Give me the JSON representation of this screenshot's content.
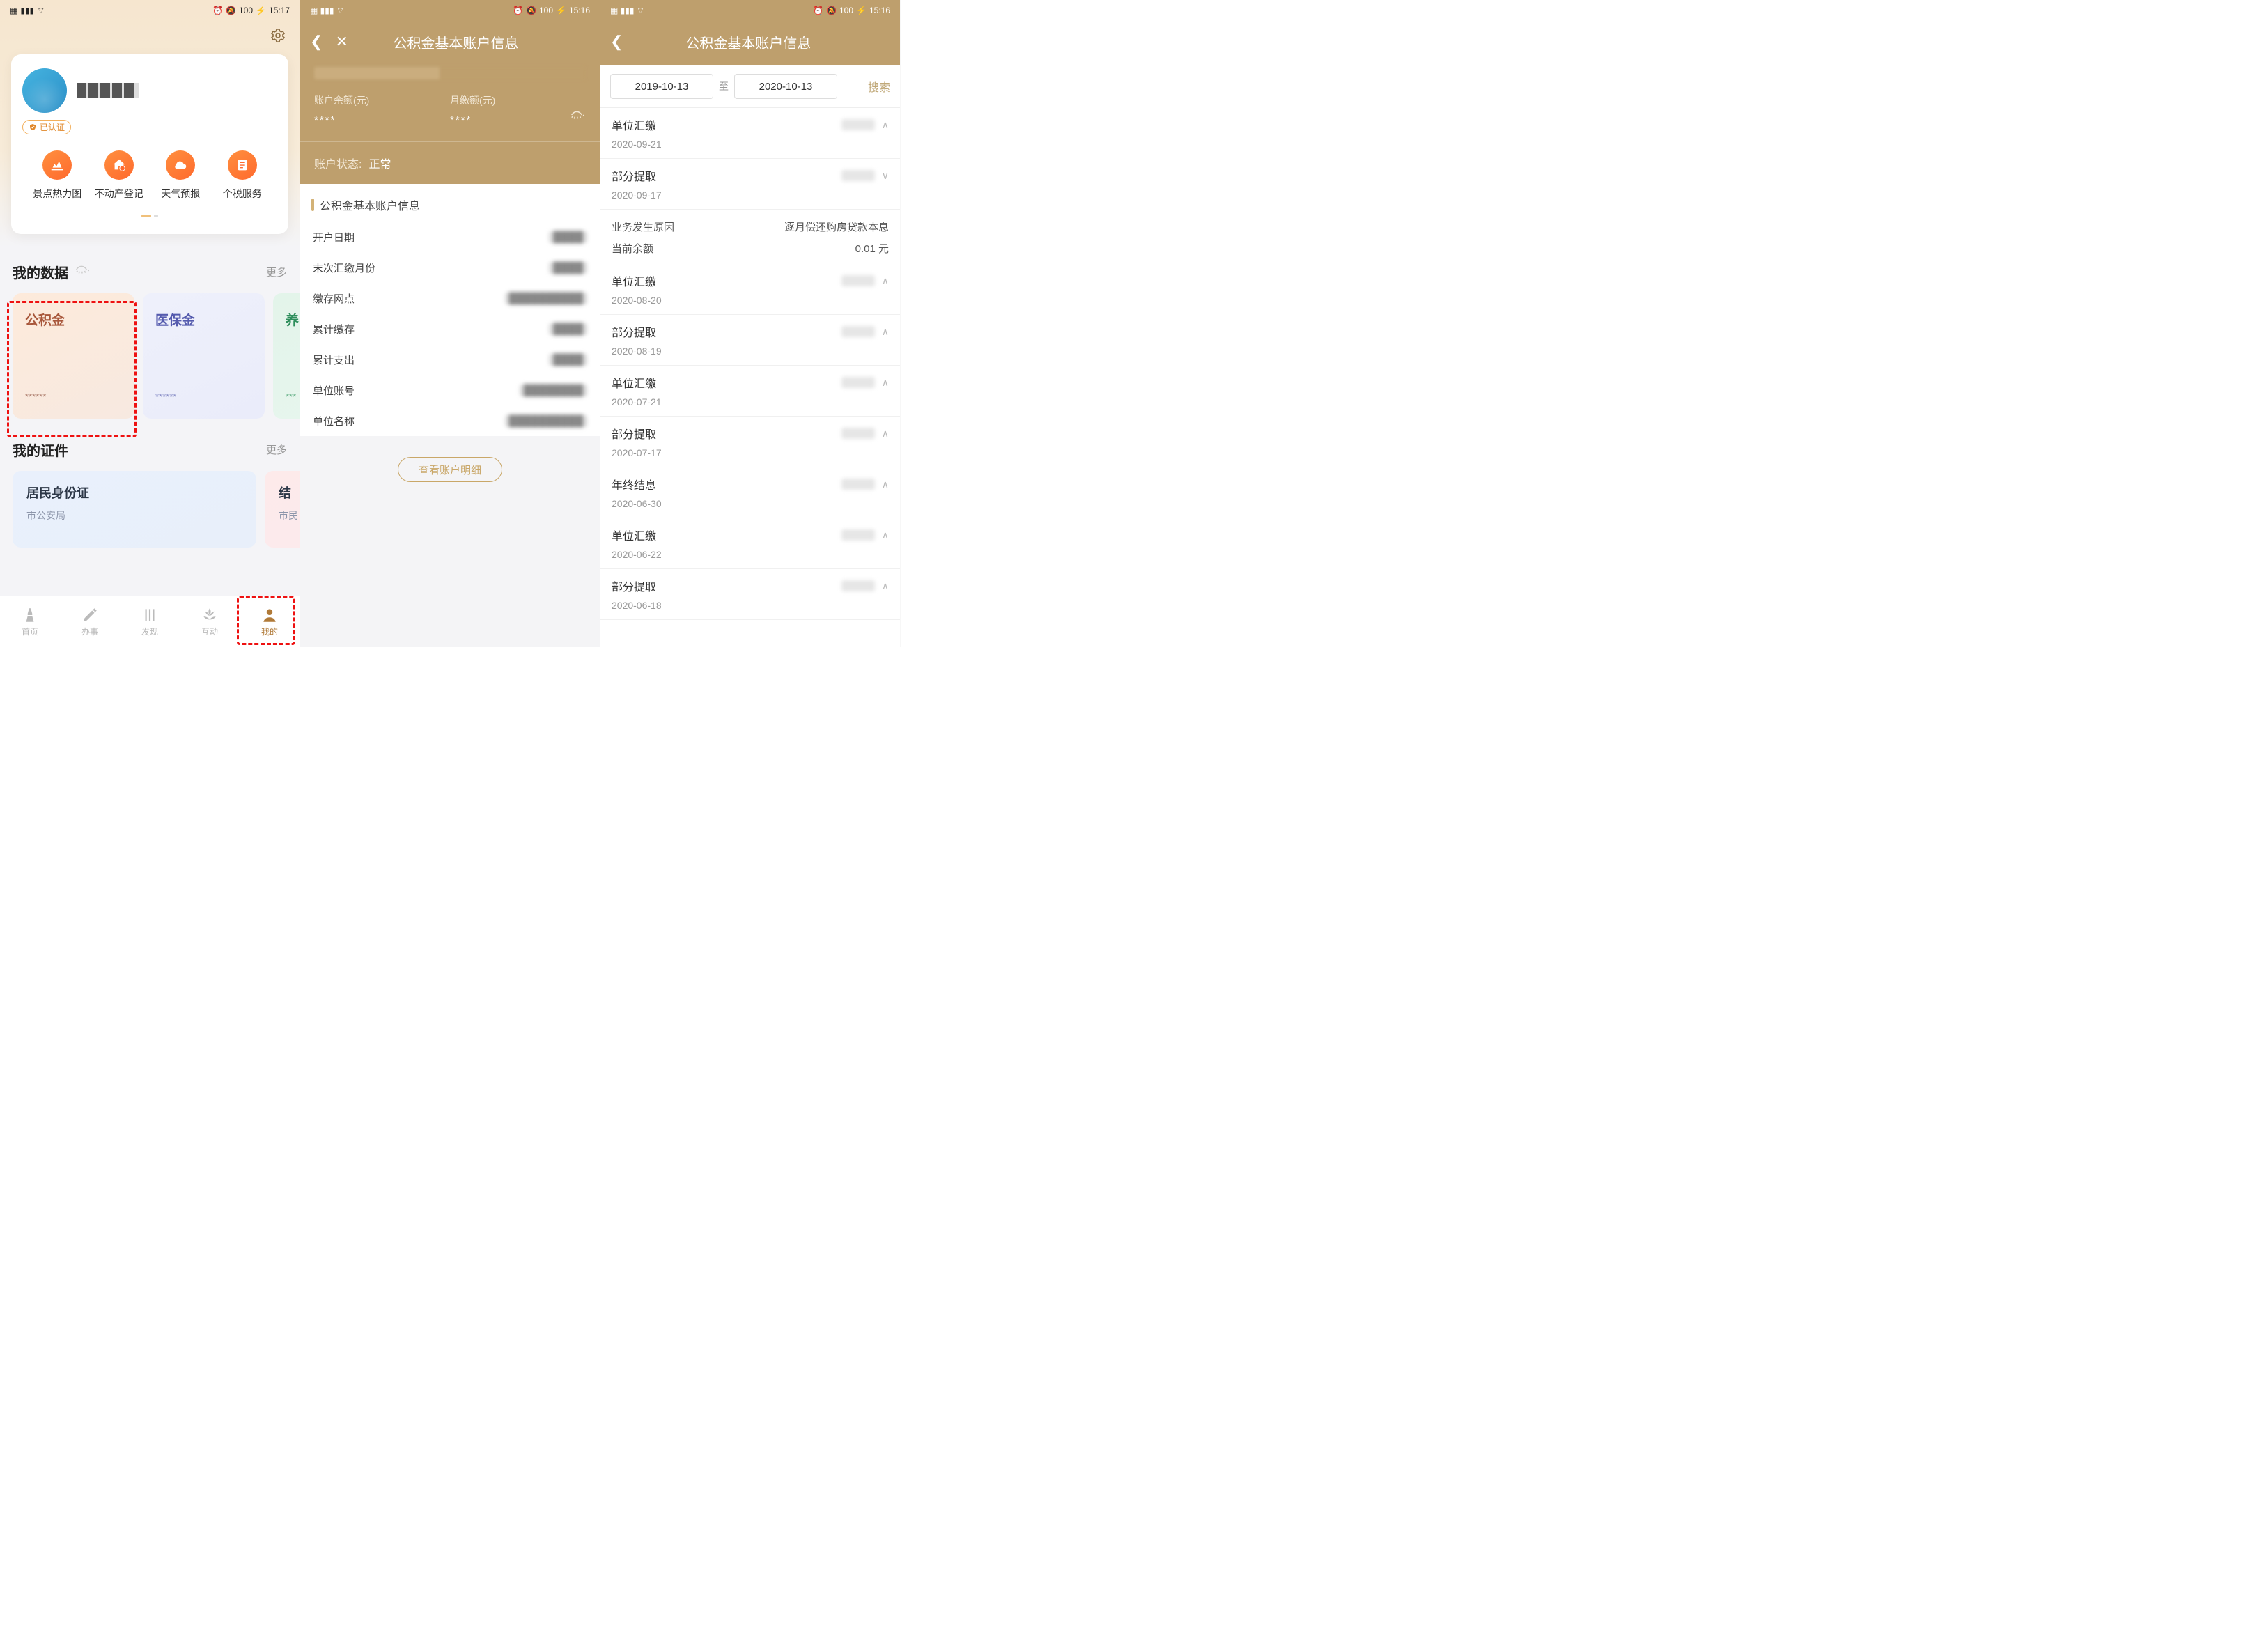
{
  "screen1": {
    "status": {
      "time": "15:17",
      "battery": "100"
    },
    "verify_label": "已认证",
    "quick": [
      {
        "label": "景点热力图",
        "icon": "map"
      },
      {
        "label": "不动产登记",
        "icon": "house"
      },
      {
        "label": "天气预报",
        "icon": "cloud"
      },
      {
        "label": "个税服务",
        "icon": "tax"
      }
    ],
    "sections": {
      "data": {
        "title": "我的数据",
        "more": "更多",
        "cards": [
          {
            "kind": "gjj",
            "name": "公积金",
            "mask": "******"
          },
          {
            "kind": "yb",
            "name": "医保金",
            "mask": "******"
          },
          {
            "kind": "yl",
            "name": "养",
            "mask": "***"
          }
        ]
      },
      "cert": {
        "title": "我的证件",
        "more": "更多",
        "cards": [
          {
            "title": "居民身份证",
            "sub": "市公安局"
          },
          {
            "title": "结",
            "sub": "市民"
          }
        ]
      }
    },
    "tabs": [
      "首页",
      "办事",
      "发现",
      "互动",
      "我的"
    ],
    "active_tab": 4
  },
  "screen2": {
    "status": {
      "time": "15:16",
      "battery": "100"
    },
    "title": "公积金基本账户信息",
    "balance_label": "账户余额(元)",
    "balance_value": "****",
    "monthly_label": "月缴额(元)",
    "monthly_value": "****",
    "acct_status_label": "账户状态:",
    "acct_status_value": "正常",
    "section_title": "公积金基本账户信息",
    "rows": [
      {
        "k": "开户日期",
        "v": "████"
      },
      {
        "k": "末次汇缴月份",
        "v": "████"
      },
      {
        "k": "缴存网点",
        "v": "██████████"
      },
      {
        "k": "累计缴存",
        "v": "████"
      },
      {
        "k": "累计支出",
        "v": "████"
      },
      {
        "k": "单位账号",
        "v": "████████"
      },
      {
        "k": "单位名称",
        "v": "██████████"
      }
    ],
    "detail_btn": "查看账户明细"
  },
  "screen3": {
    "status": {
      "time": "15:16",
      "battery": "100"
    },
    "title": "公积金基本账户信息",
    "date_from": "2019-10-13",
    "date_sep": "至",
    "date_to": "2020-10-13",
    "search": "搜索",
    "expanded_reason_label": "业务发生原因",
    "expanded_reason_value": "逐月偿还购房贷款本息",
    "expanded_balance_label": "当前余额",
    "expanded_balance_value": "0.01 元",
    "items": [
      {
        "title": "单位汇缴",
        "date": "2020-09-21",
        "expanded": false
      },
      {
        "title": "部分提取",
        "date": "2020-09-17",
        "expanded": true
      },
      {
        "title": "单位汇缴",
        "date": "2020-08-20",
        "expanded": false
      },
      {
        "title": "部分提取",
        "date": "2020-08-19",
        "expanded": false
      },
      {
        "title": "单位汇缴",
        "date": "2020-07-21",
        "expanded": false
      },
      {
        "title": "部分提取",
        "date": "2020-07-17",
        "expanded": false
      },
      {
        "title": "年终结息",
        "date": "2020-06-30",
        "expanded": false
      },
      {
        "title": "单位汇缴",
        "date": "2020-06-22",
        "expanded": false
      },
      {
        "title": "部分提取",
        "date": "2020-06-18",
        "expanded": false
      }
    ]
  }
}
